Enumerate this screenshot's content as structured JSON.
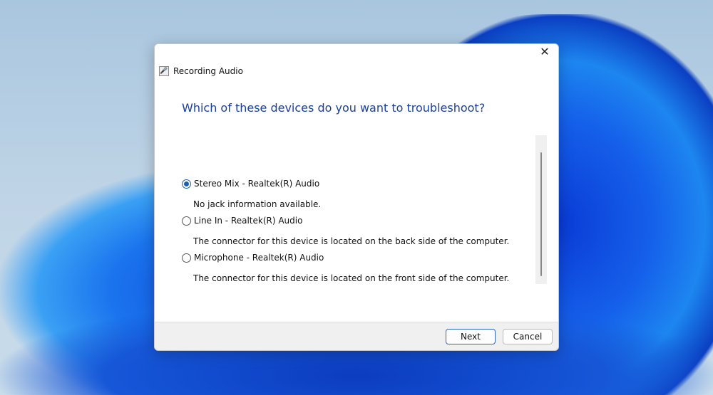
{
  "dialog": {
    "title": "Recording Audio",
    "heading": "Which of these devices do you want to troubleshoot?",
    "options": [
      {
        "label": "Stereo Mix - Realtek(R) Audio",
        "description": "No jack information available.",
        "selected": true
      },
      {
        "label": "Line In - Realtek(R) Audio",
        "description": "The connector for this device is located on the back side of the computer.",
        "selected": false
      },
      {
        "label": "Microphone - Realtek(R) Audio",
        "description": "The connector for this device is located on the front side of the computer.",
        "selected": false
      }
    ],
    "close_glyph": "✕",
    "buttons": {
      "next": "Next",
      "cancel": "Cancel"
    }
  },
  "colors": {
    "accent": "#1a5fb4",
    "heading": "#1a3f9c"
  }
}
